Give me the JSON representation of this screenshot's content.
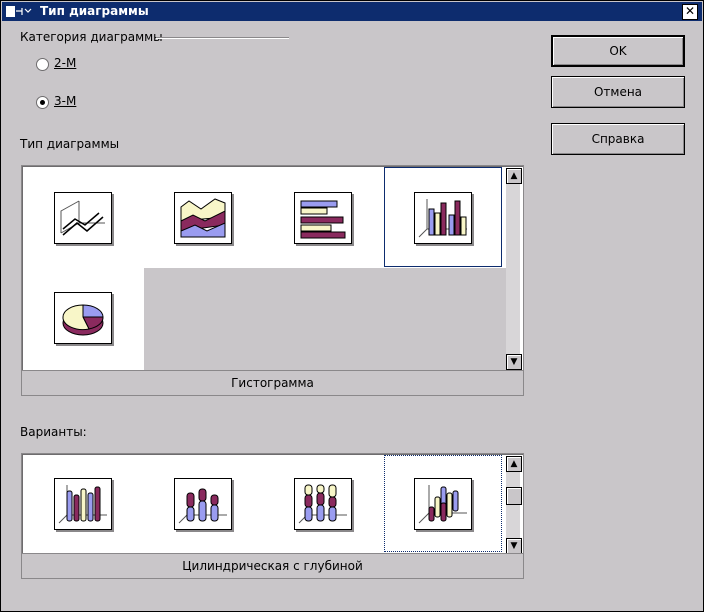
{
  "window": {
    "title": "Тип диаграммы",
    "close_glyph": "✕"
  },
  "category": {
    "label": "Категория диаграммы",
    "options": [
      {
        "label": "2-М",
        "checked": false
      },
      {
        "label": "3-М",
        "checked": true
      }
    ]
  },
  "buttons": {
    "ok": "OK",
    "cancel": "Отмена",
    "help": "Справка"
  },
  "chart_type": {
    "label": "Тип диаграммы",
    "items": [
      {
        "icon": "chart-3d-lines-icon",
        "selected": false
      },
      {
        "icon": "chart-3d-area-icon",
        "selected": false
      },
      {
        "icon": "chart-3d-bars-horizontal-icon",
        "selected": false
      },
      {
        "icon": "chart-3d-columns-icon",
        "selected": true
      },
      {
        "icon": "chart-3d-pie-icon",
        "selected": false
      }
    ],
    "caption": "Гистограмма"
  },
  "variants": {
    "label": "Варианты:",
    "items": [
      {
        "icon": "variant-cylinders-normal-icon",
        "selected": false
      },
      {
        "icon": "variant-cylinders-stacked-icon",
        "selected": false
      },
      {
        "icon": "variant-cylinders-percent-icon",
        "selected": false
      },
      {
        "icon": "variant-cylinders-deep-icon",
        "selected": true
      }
    ],
    "caption": "Цилиндрическая с глубиной"
  },
  "colors": {
    "accent": "#0d2c6e",
    "series1": "#9a9cf0",
    "series2": "#8a2a5e",
    "series3": "#f8f6c8"
  }
}
